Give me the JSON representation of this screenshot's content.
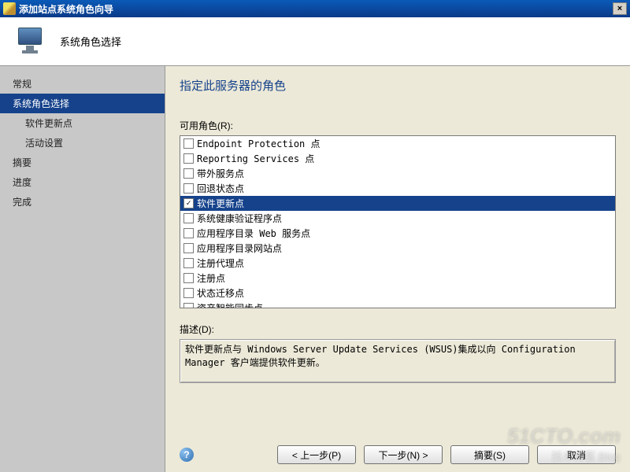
{
  "window": {
    "title": "添加站点系统角色向导",
    "close_glyph": "×"
  },
  "header": {
    "title": "系统角色选择"
  },
  "sidebar": {
    "items": [
      {
        "label": "常规",
        "sub": false,
        "selected": false
      },
      {
        "label": "系统角色选择",
        "sub": false,
        "selected": true
      },
      {
        "label": "软件更新点",
        "sub": true,
        "selected": false
      },
      {
        "label": "活动设置",
        "sub": true,
        "selected": false
      },
      {
        "label": "摘要",
        "sub": false,
        "selected": false
      },
      {
        "label": "进度",
        "sub": false,
        "selected": false
      },
      {
        "label": "完成",
        "sub": false,
        "selected": false
      }
    ]
  },
  "main": {
    "heading": "指定此服务器的角色",
    "roles_label": "可用角色(R):",
    "roles": [
      {
        "label": "Endpoint Protection 点",
        "checked": false,
        "selected": false
      },
      {
        "label": "Reporting Services 点",
        "checked": false,
        "selected": false
      },
      {
        "label": "带外服务点",
        "checked": false,
        "selected": false
      },
      {
        "label": "回退状态点",
        "checked": false,
        "selected": false
      },
      {
        "label": "软件更新点",
        "checked": true,
        "selected": true
      },
      {
        "label": "系统健康验证程序点",
        "checked": false,
        "selected": false
      },
      {
        "label": "应用程序目录 Web 服务点",
        "checked": false,
        "selected": false
      },
      {
        "label": "应用程序目录网站点",
        "checked": false,
        "selected": false
      },
      {
        "label": "注册代理点",
        "checked": false,
        "selected": false
      },
      {
        "label": "注册点",
        "checked": false,
        "selected": false
      },
      {
        "label": "状态迁移点",
        "checked": false,
        "selected": false
      },
      {
        "label": "资产智能同步点",
        "checked": false,
        "selected": false
      }
    ],
    "desc_label": "描述(D):",
    "desc_text": "软件更新点与 Windows Server Update Services (WSUS)集成以向 Configuration Manager 客户端提供软件更新。"
  },
  "buttons": {
    "help_glyph": "?",
    "prev": "< 上一步(P)",
    "next": "下一步(N) >",
    "summary": "摘要(S)",
    "cancel": "取消"
  },
  "watermark": {
    "line1": "51CTO.com",
    "line2": "技术博客  Blog"
  }
}
